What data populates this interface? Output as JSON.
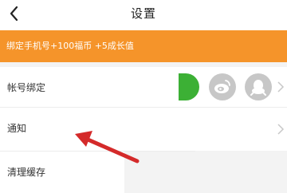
{
  "header": {
    "title": "设置"
  },
  "promo": {
    "text": "绑定手机号+100福币 +5成长值"
  },
  "rows": {
    "account": {
      "label": "帐号绑定"
    },
    "notify": {
      "label": "通知"
    },
    "cache": {
      "label": "清理缓存"
    }
  },
  "colors": {
    "promo_bg": "#f5942a",
    "wechat_green": "#3cb035",
    "icon_gray": "#c7c7c7",
    "annotation_arrow": "#d42a2a"
  },
  "icons": [
    "back-arrow-icon",
    "wechat-icon",
    "weibo-icon",
    "qq-icon",
    "chevron-right-icon",
    "annotation-arrow-icon"
  ]
}
